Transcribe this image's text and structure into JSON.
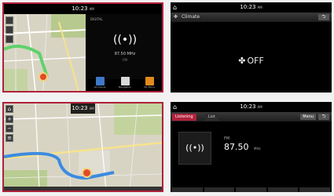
{
  "screens": [
    {
      "clock": "10:23",
      "ampm": "AM",
      "map_buttons": [
        "",
        "",
        ""
      ],
      "radio_band": "DIGITAL",
      "radio_freq": "87.50 MHz",
      "radio_sub": "FM",
      "shortcuts": [
        {
          "label": "All menus",
          "color": "#3f78c8"
        },
        {
          "label": "Navigation",
          "color": "#d8d8d8"
        },
        {
          "label": "My Menu",
          "color": "#e08a1e"
        }
      ]
    },
    {
      "clock": "10:23",
      "ampm": "AM",
      "title": "Climate",
      "back": "⮌",
      "status": "OFF"
    },
    {
      "clock": "10:23",
      "ampm": "AM",
      "home": "⌂",
      "map_buttons": [
        "+",
        "−",
        "≡"
      ]
    },
    {
      "clock": "10:23",
      "ampm": "AM",
      "tabs": [
        "Listening",
        "List"
      ],
      "menu": "Menu",
      "back": "⮌",
      "band": "FM",
      "freq": "87.50",
      "unit": "MHz"
    }
  ],
  "colors": {
    "accent": "#b0213a",
    "route_green": "#5fd16c",
    "route_blue": "#3b8be0",
    "marker": "#e24a2b"
  }
}
